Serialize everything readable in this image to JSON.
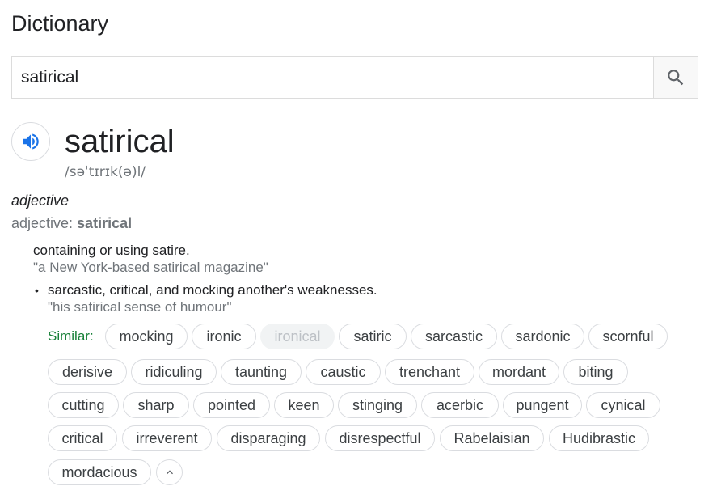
{
  "header": {
    "title": "Dictionary"
  },
  "search": {
    "query": "satirical",
    "icon": "search-icon"
  },
  "entry": {
    "audio_icon": "speaker-icon",
    "word": "satirical",
    "phonetic": "/səˈtɪrɪk(ə)l/",
    "part_of_speech": "adjective",
    "forms_label": "adjective: ",
    "forms_value": "satirical",
    "senses": [
      {
        "definition": "containing or using satire.",
        "example": "\"a New York-based satirical magazine\""
      },
      {
        "bullet": "•",
        "definition": "sarcastic, critical, and mocking another's weaknesses.",
        "example": "\"his satirical sense of humour\""
      }
    ],
    "similar_label": "Similar:",
    "similar": [
      "mocking",
      "ironic",
      "ironical",
      "satiric",
      "sarcastic",
      "sardonic",
      "scornful",
      "derisive",
      "ridiculing",
      "taunting",
      "caustic",
      "trenchant",
      "mordant",
      "biting",
      "cutting",
      "sharp",
      "pointed",
      "keen",
      "stinging",
      "acerbic",
      "pungent",
      "cynical",
      "critical",
      "irreverent",
      "disparaging",
      "disrespectful",
      "Rabelaisian",
      "Hudibrastic",
      "mordacious"
    ],
    "disabled_similar": "ironical",
    "collapse_icon": "chevron-up-icon"
  },
  "colors": {
    "accent_blue": "#1a73e8",
    "similar_green": "#188038",
    "muted_text": "#70757a"
  }
}
